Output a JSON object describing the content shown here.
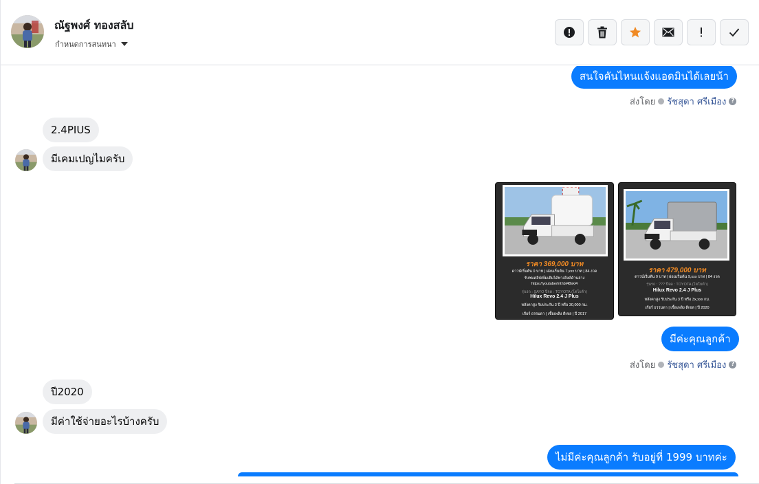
{
  "header": {
    "contact_name": "ณัฐพงศ์ ทองสลับ",
    "assign_label": "กำหนดการสนทนา",
    "toolbar": [
      {
        "name": "report-button",
        "icon": "alert-circle-icon"
      },
      {
        "name": "delete-button",
        "icon": "trash-icon"
      },
      {
        "name": "star-button",
        "icon": "star-icon"
      },
      {
        "name": "mark-unread-button",
        "icon": "envelope-icon"
      },
      {
        "name": "mark-important-button",
        "icon": "exclamation-icon"
      },
      {
        "name": "mark-done-button",
        "icon": "check-icon"
      }
    ]
  },
  "messages": {
    "m1": "สนใจคันไหนแจ้งแอดมินได้เลยน้า",
    "m2": "2.4PIUS",
    "m3": "มีเคมเปญไมครับ",
    "m4": "มีค่ะคุณลูกค้า",
    "m5": "ปี2020",
    "m6": "มีค่าใช้จ่ายอะไรบ้างครับ",
    "m7": "ไม่มีค่ะคุณลูกค้า  รับอยู่ที่ 1999  บาทค่ะ"
  },
  "sent_by": {
    "prefix": "ส่งโดย",
    "name": "รัชสุดา ศรีเมือง",
    "help": "?"
  },
  "cards": [
    {
      "price": "ราคา 369,000 บาท",
      "line1": "ดาวน์เริ่มต้น 0 บาท | ผ่อนเริ่มต้น 7,xxx บาท | 84 งวด",
      "line2": "รับชมคลิปเพิ่มเติมได้ทางลิงค์ด้านล่าง",
      "line3": "https://youtube/mthbt48skl4",
      "line4": "รุ่นรถ : SAYO ปีจด : TOYOTA (โตโยต้า)",
      "model": "Hilux Revo 2.4 J Plus",
      "line5": "หลังคาสูง รับประกัน 3 ปี หรือ 30,000 กม.",
      "line6": "เกียร์ ธรรมดา  |  เชื้อเพลิง ดีเซล  |  ปี 2017"
    },
    {
      "price": "ราคา 479,000 บาท",
      "line1": "ดาวน์เริ่มต้น 0 บาท | ผ่อนเริ่มต้น 9,xxx บาท | 84 งวด",
      "line2": "รุ่นรถ : ??? ปีจด : TOYOTA (โตโยต้า)",
      "model": "Hilux Revo 2.4 J Plus",
      "line3": "หลังคาสูง รับประกัน 3 ปี หรือ 3x,xxx กม.",
      "line4": "เกียร์ ธรรมดา  |  เชื้อเพลิง ดีเซล  |  ปี 2020"
    }
  ],
  "colors": {
    "outgoing": "#0a7cff",
    "incoming": "#eeeff1",
    "star": "#f08a24"
  }
}
